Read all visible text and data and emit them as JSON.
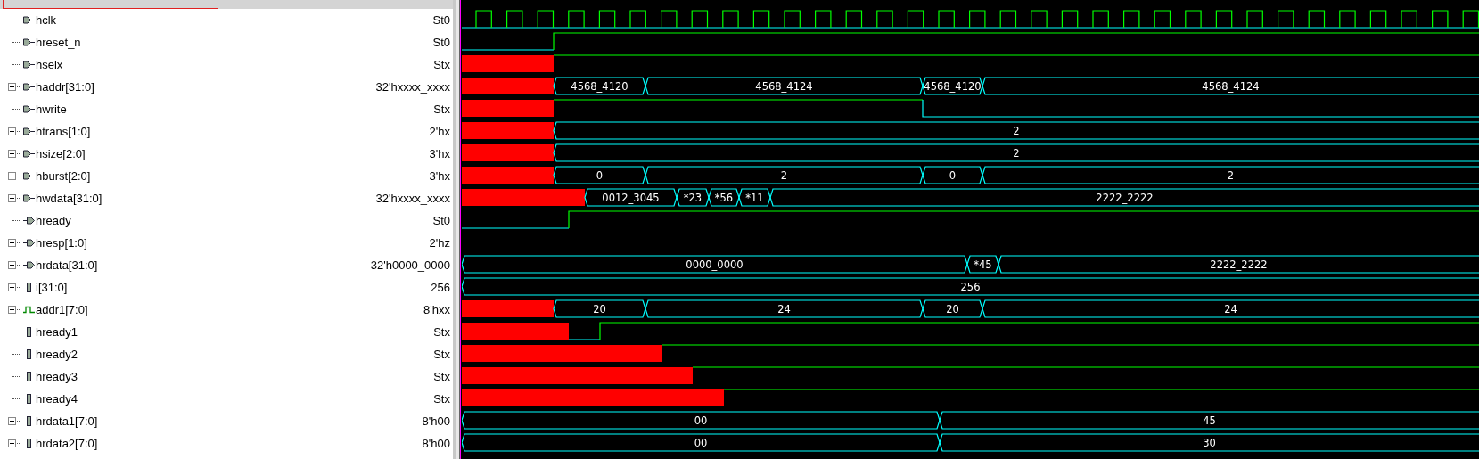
{
  "signals": [
    {
      "name": "hclk",
      "value": "St0",
      "kind": "input",
      "has_children": false,
      "wave": {
        "kind": "clock"
      }
    },
    {
      "name": "hreset_n",
      "value": "St0",
      "kind": "input",
      "has_children": false,
      "wave": {
        "kind": "bit"
      }
    },
    {
      "name": "hselx",
      "value": "Stx",
      "kind": "input",
      "has_children": false,
      "wave": {
        "kind": "bit"
      }
    },
    {
      "name": "haddr[31:0]",
      "value": "32'hxxxx_xxxx",
      "kind": "input",
      "has_children": true,
      "wave": {
        "kind": "bus",
        "segments": [
          "4568_4120",
          "4568_4124",
          "4568_4120",
          "4568_4124"
        ]
      }
    },
    {
      "name": "hwrite",
      "value": "Stx",
      "kind": "input",
      "has_children": false,
      "wave": {
        "kind": "bit"
      }
    },
    {
      "name": "htrans[1:0]",
      "value": "2'hx",
      "kind": "input",
      "has_children": true,
      "wave": {
        "kind": "bus",
        "segments": [
          "2"
        ]
      }
    },
    {
      "name": "hsize[2:0]",
      "value": "3'hx",
      "kind": "input",
      "has_children": true,
      "wave": {
        "kind": "bus",
        "segments": [
          "2"
        ]
      }
    },
    {
      "name": "hburst[2:0]",
      "value": "3'hx",
      "kind": "input",
      "has_children": true,
      "wave": {
        "kind": "bus",
        "segments": [
          "0",
          "2",
          "0",
          "2"
        ]
      }
    },
    {
      "name": "hwdata[31:0]",
      "value": "32'hxxxx_xxxx",
      "kind": "input",
      "has_children": true,
      "wave": {
        "kind": "bus",
        "segments": [
          "0012_3045",
          "*23",
          "*56",
          "*11",
          "2222_2222"
        ]
      }
    },
    {
      "name": "hready",
      "value": "St0",
      "kind": "output",
      "has_children": false,
      "wave": {
        "kind": "bit"
      }
    },
    {
      "name": "hresp[1:0]",
      "value": "2'hz",
      "kind": "output",
      "has_children": true,
      "wave": {
        "kind": "z"
      }
    },
    {
      "name": "hrdata[31:0]",
      "value": "32'h0000_0000",
      "kind": "output",
      "has_children": true,
      "wave": {
        "kind": "bus",
        "segments": [
          "0000_0000",
          "*45",
          "2222_2222"
        ]
      }
    },
    {
      "name": "i[31:0]",
      "value": "256",
      "kind": "reg",
      "has_children": true,
      "wave": {
        "kind": "bus",
        "segments": [
          "256"
        ]
      }
    },
    {
      "name": "addr1[7:0]",
      "value": "8'hxx",
      "kind": "net",
      "has_children": true,
      "wave": {
        "kind": "bus",
        "segments": [
          "20",
          "24",
          "20",
          "24"
        ]
      }
    },
    {
      "name": "hready1",
      "value": "Stx",
      "kind": "reg",
      "has_children": false,
      "wave": {
        "kind": "bit"
      }
    },
    {
      "name": "hready2",
      "value": "Stx",
      "kind": "reg",
      "has_children": false,
      "wave": {
        "kind": "bit"
      }
    },
    {
      "name": "hready3",
      "value": "Stx",
      "kind": "reg",
      "has_children": false,
      "wave": {
        "kind": "bit"
      }
    },
    {
      "name": "hready4",
      "value": "Stx",
      "kind": "reg",
      "has_children": false,
      "wave": {
        "kind": "bit"
      }
    },
    {
      "name": "hrdata1[7:0]",
      "value": "8'h00",
      "kind": "reg",
      "has_children": true,
      "wave": {
        "kind": "bus",
        "segments": [
          "00",
          "45"
        ]
      }
    },
    {
      "name": "hrdata2[7:0]",
      "value": "8'h00",
      "kind": "reg",
      "has_children": true,
      "wave": {
        "kind": "bus",
        "segments": [
          "00",
          "30"
        ]
      }
    }
  ]
}
